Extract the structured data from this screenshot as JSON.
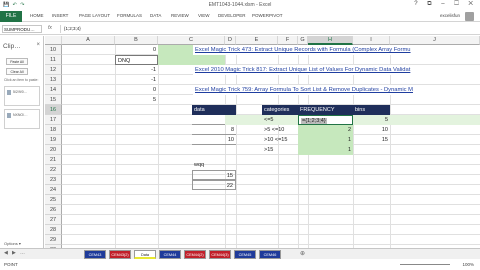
{
  "window": {
    "title": "EMT1043-1044.xlsm - Excel",
    "qat_icons": [
      "save-icon",
      "undo-icon",
      "redo-icon"
    ],
    "controls": [
      "?",
      "⧉",
      "–",
      "☐",
      "✕"
    ]
  },
  "ribbon": {
    "file": "FILE",
    "tabs": [
      "HOME",
      "INSERT",
      "PAGE LAYOUT",
      "FORMULAS",
      "DATA",
      "REVIEW",
      "VIEW",
      "DEVELOPER",
      "POWERPIVOT"
    ],
    "user": "excelisfun"
  },
  "formula_bar": {
    "name_box": "SUMPRODU…",
    "fx": "fx",
    "formula": "{1;2;3;4}"
  },
  "clipboard": {
    "title": "Clip…",
    "close": "×",
    "paste_all": "Paste All",
    "clear_all": "Clear All",
    "hint": "Click an item to paste:",
    "items": [
      "5/2/9/0…",
      "NXNO/…"
    ],
    "options": "Options ▾"
  },
  "grid": {
    "columns": [
      "A",
      "B",
      "C",
      "D",
      "E",
      "F",
      "G",
      "H",
      "I",
      "J"
    ],
    "selected_column": "H",
    "rows": [
      "10",
      "11",
      "12",
      "13",
      "14",
      "15",
      "16",
      "17",
      "18",
      "19",
      "20",
      "21",
      "22",
      "23",
      "24",
      "25",
      "26",
      "27",
      "28",
      "29",
      "30"
    ],
    "selected_row": "16",
    "b_values": [
      "0",
      "DNQ",
      "-1",
      "-1",
      "0",
      "5"
    ],
    "links": [
      "Excel Magic Trick 473: Extract Unique Records with Formula (Complex Array Formu",
      "Excel 2010 Magic Trick 817: Extract Unique List of Values For Dynamic Data Validat",
      "Excel Magic Trick 759: Array Formula To Sort List & Remove Duplicates - Dynamic M"
    ],
    "data_header": "data",
    "data_values": [
      "5",
      "8",
      "10"
    ],
    "categories_header": "categories",
    "frequency_header": "FREQUENCY",
    "bins_header": "bins",
    "categories": [
      "<=5",
      ">5 <=10",
      ">10 <=15",
      ">15"
    ],
    "editing_text": "={1;2;3;4}",
    "frequency_values": [
      "",
      "2",
      "1",
      "1"
    ],
    "bins_values": [
      "5",
      "10",
      "15",
      ""
    ],
    "wqq_label": "wqq",
    "wqq_values": [
      "15",
      "22"
    ]
  },
  "sheet_tabs": [
    {
      "label": "CEM43",
      "color": "#1f3b9a"
    },
    {
      "label": "CEM43(2)",
      "color": "#c0202a"
    },
    {
      "label": "Data",
      "color": "#e8e830",
      "active": true
    },
    {
      "label": "CEM44",
      "color": "#1f3b9a"
    },
    {
      "label": "CEM44(2)",
      "color": "#c0202a"
    },
    {
      "label": "CEM44(3)",
      "color": "#c0202a"
    },
    {
      "label": "CEM45",
      "color": "#1f3b9a"
    },
    {
      "label": "CEM46",
      "color": "#1f3b9a"
    }
  ],
  "status": {
    "mode": "POINT",
    "zoom": "100%"
  }
}
